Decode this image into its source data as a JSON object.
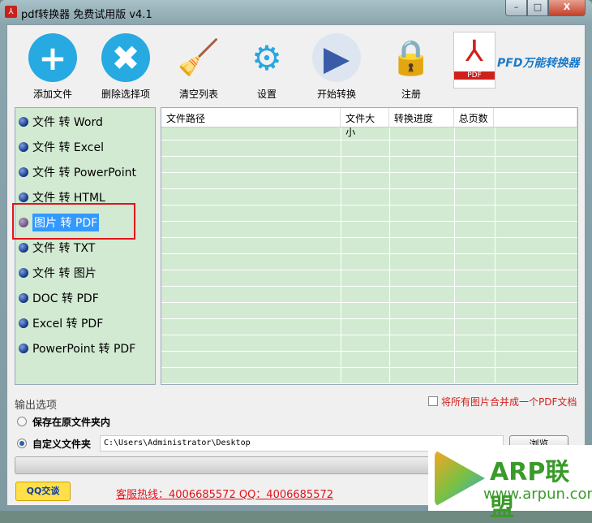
{
  "window": {
    "title": "pdf转换器 免费试用版 v4.1",
    "min": "–",
    "max": "□",
    "close": "X"
  },
  "toolbar": [
    {
      "label": "添加文件",
      "icon": "add-icon",
      "glyph": "+"
    },
    {
      "label": "删除选择项",
      "icon": "delete-icon",
      "glyph": "✖"
    },
    {
      "label": "清空列表",
      "icon": "broom-icon",
      "glyph": "🧹"
    },
    {
      "label": "设置",
      "icon": "gear-icon",
      "glyph": "⚙"
    },
    {
      "label": "开始转换",
      "icon": "play-icon",
      "glyph": "▶"
    },
    {
      "label": "注册",
      "icon": "lock-icon",
      "glyph": "🔒"
    }
  ],
  "brand": {
    "text": "PFD万能转换器",
    "pdf": "PDF"
  },
  "modes": [
    "文件 转 Word",
    "文件 转 Excel",
    "文件 转 PowerPoint",
    "文件 转 HTML",
    "图片 转 PDF",
    "文件 转 TXT",
    "文件 转 图片",
    "DOC 转 PDF",
    "Excel 转 PDF",
    "PowerPoint 转 PDF"
  ],
  "selected_mode": 4,
  "table": {
    "columns": [
      "文件路径",
      "文件大小",
      "转换进度",
      "总页数",
      ""
    ]
  },
  "output": {
    "title": "输出选项",
    "merge_label": "将所有图片合并成一个PDF文档",
    "merge_checked": false,
    "opt_original": "保存在原文件夹内",
    "opt_custom": "自定义文件夹",
    "path": "C:\\Users\\Administrator\\Desktop",
    "browse": "浏览"
  },
  "progress": 0,
  "footer": {
    "qq": "QQ交谈",
    "hotline": "客服热线：4006685572 QQ：4006685572"
  },
  "watermark": {
    "name": "ARP联盟",
    "url": "www.arpun.com"
  },
  "colors": {
    "panel": "#d2ead2",
    "accent": "#3399ff",
    "red": "#e0141c"
  }
}
